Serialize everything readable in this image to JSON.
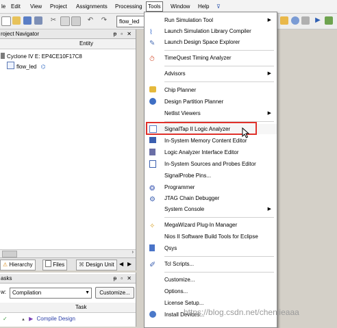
{
  "menubar": {
    "items": [
      "le",
      "Edit",
      "View",
      "Project",
      "Assignments",
      "Processing",
      "Tools",
      "Window",
      "Help",
      "⊽"
    ],
    "active": "Tools"
  },
  "toolbar": {
    "combo_value": "flow_led"
  },
  "navigator": {
    "title": "roject Navigator",
    "controls": "ᵽ ▫ ✕",
    "column": "Entity",
    "device": "Cyclone IV E: EP4CE10F17C8",
    "top_entity": "flow_led"
  },
  "nav_tabs": {
    "hierarchy": "Hierarchy",
    "files": "Files",
    "design_units": "Design Unit"
  },
  "tasks": {
    "title": "asks",
    "controls": "ᵽ ▫ ✕",
    "flow_label": "w:",
    "flow_value": "Compilation",
    "customize_label": "Customize...",
    "column": "Task",
    "first_task": "Compile Design"
  },
  "tools_menu": {
    "items": [
      {
        "label": "Run Simulation Tool",
        "submenu": true,
        "icon": "none"
      },
      {
        "label": "Launch Simulation Library Compiler",
        "icon": "library-compiler-icon"
      },
      {
        "label": "Launch Design Space Explorer",
        "icon": "dse-icon"
      },
      {
        "label": "TimeQuest Timing Analyzer",
        "icon": "timequest-icon"
      },
      {
        "label": "Advisors",
        "submenu": true,
        "icon": "none"
      },
      {
        "label": "Chip Planner",
        "icon": "chip-planner-icon"
      },
      {
        "label": "Design Partition Planner",
        "icon": "partition-planner-icon"
      },
      {
        "label": "Netlist Viewers",
        "submenu": true,
        "icon": "none"
      },
      {
        "label": "SignalTap II Logic Analyzer",
        "icon": "signaltap-icon"
      },
      {
        "label": "In-System Memory Content Editor",
        "icon": "memory-editor-icon"
      },
      {
        "label": "Logic Analyzer Interface Editor",
        "icon": "lai-editor-icon"
      },
      {
        "label": "In-System Sources and Probes Editor",
        "icon": "sources-probes-icon"
      },
      {
        "label": "SignalProbe Pins...",
        "icon": "none"
      },
      {
        "label": "Programmer",
        "icon": "programmer-icon"
      },
      {
        "label": "JTAG Chain Debugger",
        "icon": "jtag-icon"
      },
      {
        "label": "System Console",
        "submenu": true,
        "icon": "none"
      },
      {
        "label": "MegaWizard Plug-In Manager",
        "icon": "megawizard-icon"
      },
      {
        "label": "Nios II Software Build Tools for Eclipse",
        "icon": "none"
      },
      {
        "label": "Qsys",
        "icon": "qsys-icon"
      },
      {
        "label": "Tcl Scripts...",
        "icon": "tcl-icon"
      },
      {
        "label": "Customize...",
        "icon": "none"
      },
      {
        "label": "Options...",
        "icon": "none"
      },
      {
        "label": "License Setup...",
        "icon": "none"
      },
      {
        "label": "Install Devices...",
        "icon": "install-icon"
      }
    ]
  },
  "watermark": "https://blog.csdn.net/chenjieaaa",
  "colors": {
    "highlight_border": "#e0302a",
    "menu_bg": "#ffffff"
  }
}
